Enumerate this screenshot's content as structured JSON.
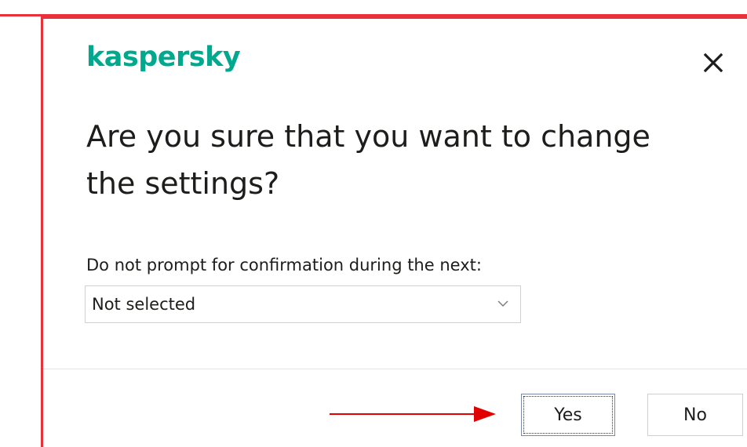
{
  "brand": {
    "logo_text": "kaspersky",
    "color": "#00a88e"
  },
  "dialog": {
    "title": "Are you sure that you want to change the settings?",
    "prompt_label": "Do not prompt for confirmation during the next:",
    "select": {
      "value": "Not selected"
    },
    "buttons": {
      "yes_label": "Yes",
      "no_label": "No"
    },
    "close_icon": "close-icon"
  },
  "colors": {
    "frame_accent": "#e8313a",
    "arrow": "#e00000",
    "text": "#1d1d1b"
  }
}
